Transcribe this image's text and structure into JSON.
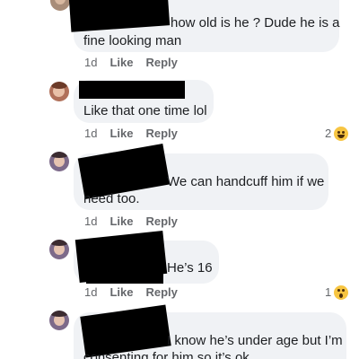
{
  "comments": [
    {
      "text_lines": [
        "how old is he ? Dude he is a",
        "fine looking man"
      ],
      "time": "1d",
      "like_label": "Like",
      "reply_label": "Reply"
    },
    {
      "text_lines": [
        "Like that one time lol"
      ],
      "time": "1d",
      "like_label": "Like",
      "reply_label": "Reply",
      "reaction_count": "2",
      "reaction_icon": "haha-emoji-icon"
    },
    {
      "text_lines": [
        "We can handcuff him if we",
        "need too."
      ],
      "time": "1d",
      "like_label": "Like",
      "reply_label": "Reply"
    },
    {
      "text_lines": [
        "He’s 16"
      ],
      "time": "1d",
      "like_label": "Like",
      "reply_label": "Reply",
      "reaction_count": "1",
      "reaction_icon": "wow-emoji-icon"
    },
    {
      "text_lines": [
        "I know he’s under age but I’m",
        "consenting for him so it’s ok"
      ]
    }
  ],
  "colors": {
    "bubble": "#f0f2f5",
    "text": "#1c1e21",
    "meta": "#65676b",
    "redaction": "#000000",
    "emoji": "#f7c542"
  }
}
